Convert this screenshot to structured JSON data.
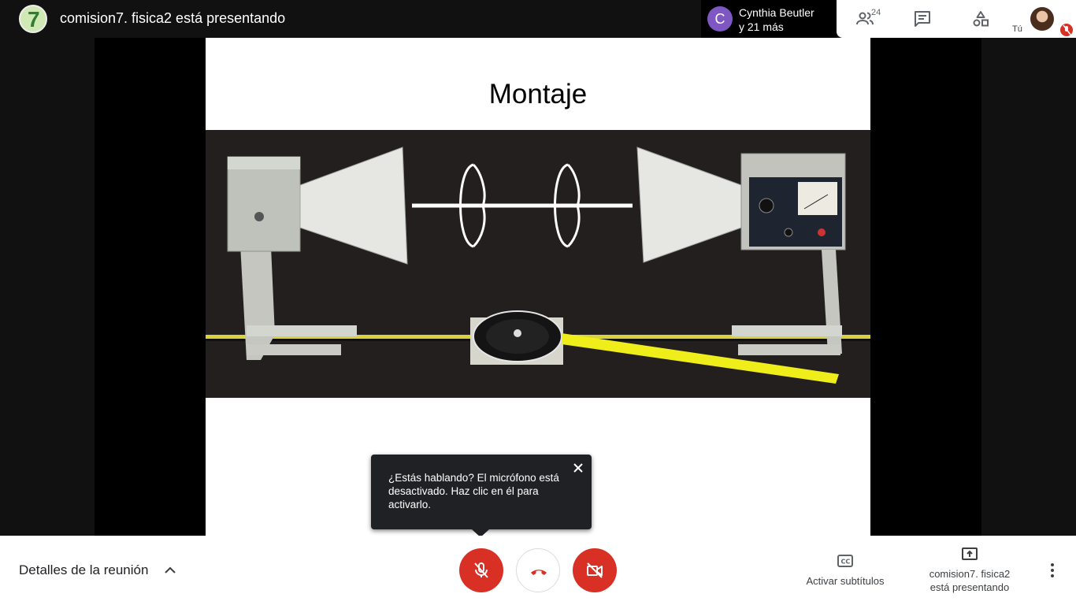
{
  "topbar": {
    "presenter_avatar_glyph": "7",
    "presenter_title": "comision7. fisica2 está presentando",
    "participant": {
      "avatar_letter": "C",
      "name": "Cynthia Beutler",
      "more": "y 21 más",
      "avatar_color": "#7e57c2"
    },
    "people_count": "24",
    "self_label": "Tú",
    "icons": [
      "people-icon",
      "chat-icon",
      "activities-icon",
      "mic-off-icon"
    ]
  },
  "slide": {
    "title": "Montaje"
  },
  "tooltip": {
    "message": "¿Estás hablando? El micrófono está desactivado. Haz clic en él para activarlo."
  },
  "bottombar": {
    "details_label": "Detalles de la reunión",
    "captions_label": "Activar subtítulos",
    "presenting_line1": "comision7. fisica2",
    "presenting_line2": "está presentando",
    "accent_red": "#d93025"
  }
}
